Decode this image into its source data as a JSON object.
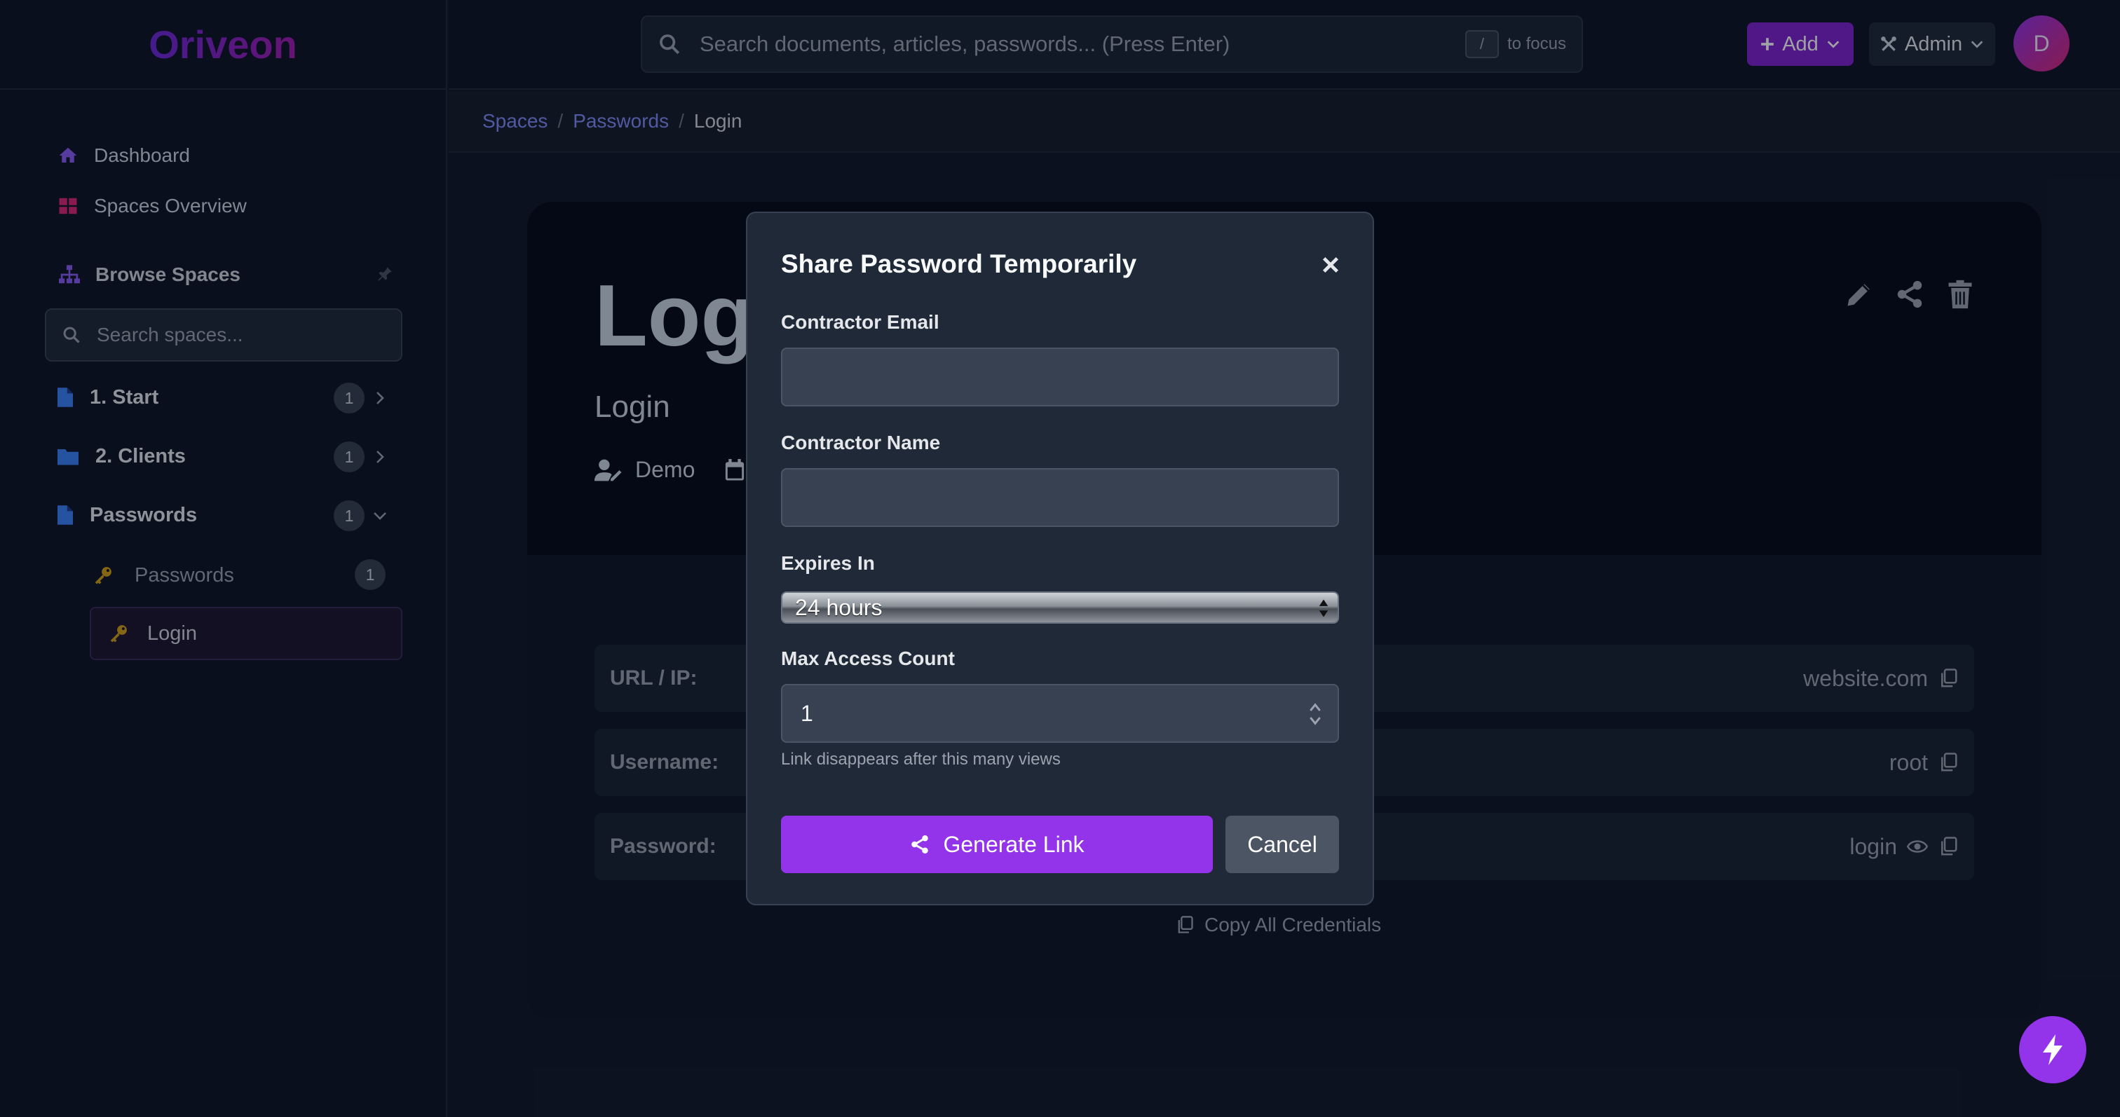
{
  "app": {
    "logo": "Oriveon"
  },
  "header": {
    "search_placeholder": "Search documents, articles, passwords... (Press Enter)",
    "shortcut_key": "/",
    "shortcut_hint": "to focus",
    "add_label": "Add",
    "admin_label": "Admin",
    "avatar_initial": "D"
  },
  "sidebar": {
    "dashboard": "Dashboard",
    "spaces_overview": "Spaces Overview",
    "browse_spaces": "Browse Spaces",
    "search_placeholder": "Search spaces...",
    "tree": [
      {
        "label": "1. Start",
        "count": "1"
      },
      {
        "label": "2. Clients",
        "count": "1"
      },
      {
        "label": "Passwords",
        "count": "1"
      }
    ],
    "sub_items": [
      {
        "label": "Passwords",
        "count": "1"
      },
      {
        "label": "Login"
      }
    ]
  },
  "breadcrumb": {
    "items": [
      "Spaces",
      "Passwords"
    ],
    "current": "Login"
  },
  "entry": {
    "title": "Login",
    "subtitle": "Login",
    "owner": "Demo",
    "fields": [
      {
        "label": "URL / IP:",
        "value": "website.com"
      },
      {
        "label": "Username:",
        "value": "root"
      },
      {
        "label": "Password:",
        "value": "login"
      }
    ],
    "copy_all": "Copy All Credentials"
  },
  "modal": {
    "title": "Share Password Temporarily",
    "email_label": "Contractor Email",
    "email_value": "",
    "name_label": "Contractor Name",
    "name_value": "",
    "expires_label": "Expires In",
    "expires_value": "24 hours",
    "max_label": "Max Access Count",
    "max_value": "1",
    "max_help": "Link disappears after this many views",
    "generate_label": "Generate Link",
    "cancel_label": "Cancel"
  },
  "colors": {
    "accent": "#9333ea",
    "background": "#111827",
    "sidebar": "#0d1422",
    "link": "#818cf8",
    "key_icon": "#d4a017"
  },
  "icons": [
    "home-icon",
    "grid-icon",
    "sitemap-icon",
    "pin-icon",
    "search-icon",
    "file-icon",
    "folder-icon",
    "chevron-right-icon",
    "chevron-down-icon",
    "key-icon",
    "plus-icon",
    "tools-icon",
    "edit-icon",
    "share-icon",
    "trash-icon",
    "user-edit-icon",
    "calendar-icon",
    "copy-icon",
    "eye-icon",
    "close-icon",
    "bolt-icon"
  ]
}
